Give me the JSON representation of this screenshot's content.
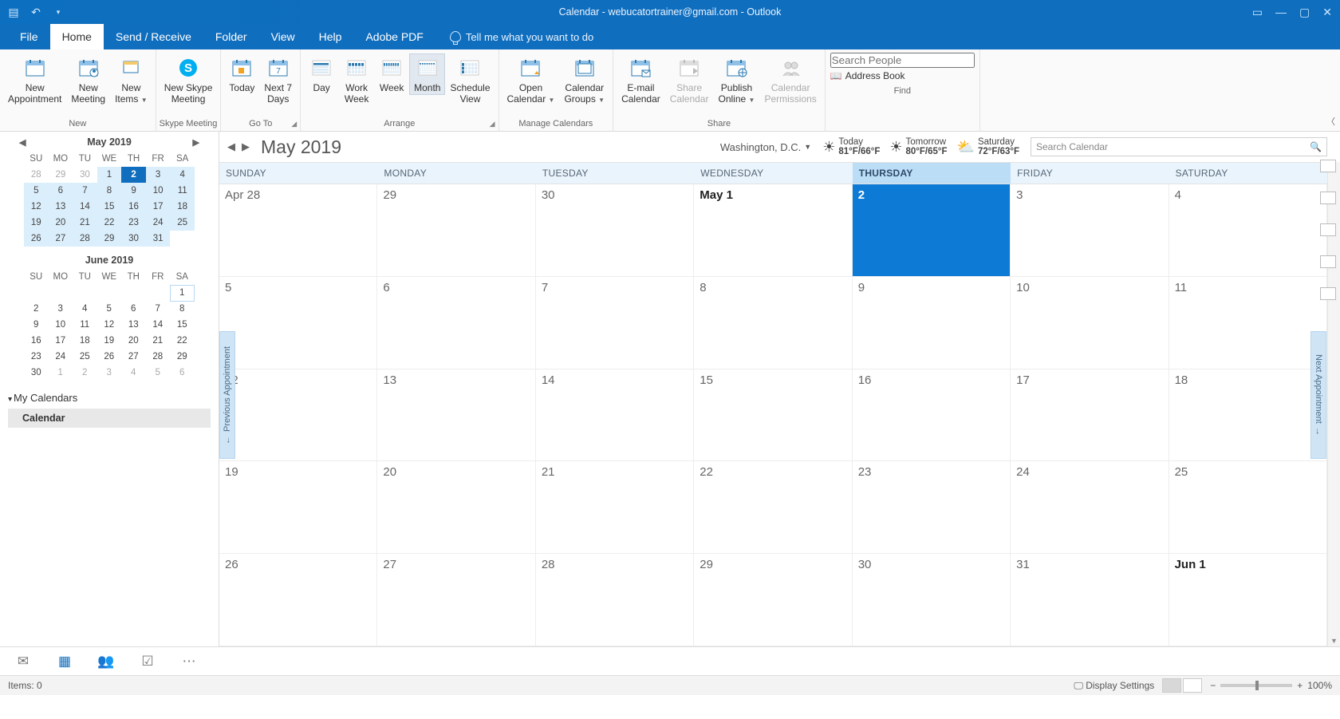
{
  "titlebar": {
    "title": "Calendar - webucatortrainer@gmail.com  -  Outlook"
  },
  "tabs": [
    "File",
    "Home",
    "Send / Receive",
    "Folder",
    "View",
    "Help",
    "Adobe PDF"
  ],
  "active_tab": "Home",
  "tellme": "Tell me what you want to do",
  "ribbon": {
    "groups": [
      {
        "label": "New",
        "buttons": [
          {
            "l1": "New",
            "l2": "Appointment",
            "icon": "cal",
            "drop": false
          },
          {
            "l1": "New",
            "l2": "Meeting",
            "icon": "people",
            "drop": false
          },
          {
            "l1": "New",
            "l2": "Items",
            "icon": "items",
            "drop": true
          }
        ]
      },
      {
        "label": "Skype Meeting",
        "buttons": [
          {
            "l1": "New Skype",
            "l2": "Meeting",
            "icon": "skype"
          }
        ]
      },
      {
        "label": "Go To",
        "launcher": true,
        "buttons": [
          {
            "l1": "Today",
            "l2": "",
            "icon": "today"
          },
          {
            "l1": "Next 7",
            "l2": "Days",
            "icon": "next7"
          }
        ]
      },
      {
        "label": "Arrange",
        "launcher": true,
        "buttons": [
          {
            "l1": "Day",
            "l2": "",
            "icon": "day"
          },
          {
            "l1": "Work",
            "l2": "Week",
            "icon": "wweek"
          },
          {
            "l1": "Week",
            "l2": "",
            "icon": "week"
          },
          {
            "l1": "Month",
            "l2": "",
            "icon": "month",
            "selected": true
          },
          {
            "l1": "Schedule",
            "l2": "View",
            "icon": "sched"
          }
        ]
      },
      {
        "label": "Manage Calendars",
        "buttons": [
          {
            "l1": "Open",
            "l2": "Calendar",
            "icon": "opencal",
            "drop": true
          },
          {
            "l1": "Calendar",
            "l2": "Groups",
            "icon": "calgrp",
            "drop": true
          }
        ]
      },
      {
        "label": "Share",
        "buttons": [
          {
            "l1": "E-mail",
            "l2": "Calendar",
            "icon": "emailcal"
          },
          {
            "l1": "Share",
            "l2": "Calendar",
            "icon": "sharecal",
            "disabled": true
          },
          {
            "l1": "Publish",
            "l2": "Online",
            "icon": "pub",
            "drop": true
          },
          {
            "l1": "Calendar",
            "l2": "Permissions",
            "icon": "perm",
            "disabled": true
          }
        ]
      }
    ],
    "find": {
      "search_ph": "Search People",
      "addressbook": "Address Book",
      "label": "Find"
    }
  },
  "mini_months": [
    {
      "title": "May 2019",
      "dow": [
        "SU",
        "MO",
        "TU",
        "WE",
        "TH",
        "FR",
        "SA"
      ],
      "weeks": [
        [
          {
            "d": "28",
            "o": 1
          },
          {
            "d": "29",
            "o": 1
          },
          {
            "d": "30",
            "o": 1
          },
          {
            "d": "1",
            "m": 1
          },
          {
            "d": "2",
            "t": 1
          },
          {
            "d": "3",
            "m": 1
          },
          {
            "d": "4",
            "m": 1
          }
        ],
        [
          {
            "d": "5",
            "m": 1
          },
          {
            "d": "6",
            "m": 1
          },
          {
            "d": "7",
            "m": 1
          },
          {
            "d": "8",
            "m": 1
          },
          {
            "d": "9",
            "m": 1
          },
          {
            "d": "10",
            "m": 1
          },
          {
            "d": "11",
            "m": 1
          }
        ],
        [
          {
            "d": "12",
            "m": 1
          },
          {
            "d": "13",
            "m": 1
          },
          {
            "d": "14",
            "m": 1
          },
          {
            "d": "15",
            "m": 1
          },
          {
            "d": "16",
            "m": 1
          },
          {
            "d": "17",
            "m": 1
          },
          {
            "d": "18",
            "m": 1
          }
        ],
        [
          {
            "d": "19",
            "m": 1
          },
          {
            "d": "20",
            "m": 1
          },
          {
            "d": "21",
            "m": 1
          },
          {
            "d": "22",
            "m": 1
          },
          {
            "d": "23",
            "m": 1
          },
          {
            "d": "24",
            "m": 1
          },
          {
            "d": "25",
            "m": 1
          }
        ],
        [
          {
            "d": "26",
            "m": 1
          },
          {
            "d": "27",
            "m": 1
          },
          {
            "d": "28",
            "m": 1
          },
          {
            "d": "29",
            "m": 1
          },
          {
            "d": "30",
            "m": 1
          },
          {
            "d": "31",
            "m": 1
          },
          {
            "d": ""
          }
        ]
      ]
    },
    {
      "title": "June 2019",
      "dow": [
        "SU",
        "MO",
        "TU",
        "WE",
        "TH",
        "FR",
        "SA"
      ],
      "weeks": [
        [
          {
            "d": ""
          },
          {
            "d": ""
          },
          {
            "d": ""
          },
          {
            "d": ""
          },
          {
            "d": ""
          },
          {
            "d": ""
          },
          {
            "d": "1",
            "b": 1
          }
        ],
        [
          {
            "d": "2"
          },
          {
            "d": "3"
          },
          {
            "d": "4"
          },
          {
            "d": "5"
          },
          {
            "d": "6"
          },
          {
            "d": "7"
          },
          {
            "d": "8"
          }
        ],
        [
          {
            "d": "9"
          },
          {
            "d": "10"
          },
          {
            "d": "11"
          },
          {
            "d": "12"
          },
          {
            "d": "13"
          },
          {
            "d": "14"
          },
          {
            "d": "15"
          }
        ],
        [
          {
            "d": "16"
          },
          {
            "d": "17"
          },
          {
            "d": "18"
          },
          {
            "d": "19"
          },
          {
            "d": "20"
          },
          {
            "d": "21"
          },
          {
            "d": "22"
          }
        ],
        [
          {
            "d": "23"
          },
          {
            "d": "24"
          },
          {
            "d": "25"
          },
          {
            "d": "26"
          },
          {
            "d": "27"
          },
          {
            "d": "28"
          },
          {
            "d": "29"
          }
        ],
        [
          {
            "d": "30"
          },
          {
            "d": "1",
            "o": 1
          },
          {
            "d": "2",
            "o": 1
          },
          {
            "d": "3",
            "o": 1
          },
          {
            "d": "4",
            "o": 1
          },
          {
            "d": "5",
            "o": 1
          },
          {
            "d": "6",
            "o": 1
          }
        ]
      ]
    }
  ],
  "mycal": {
    "header": "My Calendars",
    "item": "Calendar"
  },
  "calview": {
    "title": "May 2019",
    "location": "Washington,  D.C.",
    "forecast": [
      {
        "label": "Today",
        "temp": "81°F/66°F"
      },
      {
        "label": "Tomorrow",
        "temp": "80°F/65°F"
      },
      {
        "label": "Saturday",
        "temp": "72°F/63°F"
      }
    ],
    "search_ph": "Search Calendar",
    "dow": [
      "SUNDAY",
      "MONDAY",
      "TUESDAY",
      "WEDNESDAY",
      "THURSDAY",
      "FRIDAY",
      "SATURDAY"
    ],
    "today_col": 4,
    "cells": [
      {
        "t": "Apr 28"
      },
      {
        "t": "29"
      },
      {
        "t": "30"
      },
      {
        "t": "May 1",
        "b": 1
      },
      {
        "t": "2",
        "today": 1
      },
      {
        "t": "3"
      },
      {
        "t": "4"
      },
      {
        "t": "5"
      },
      {
        "t": "6"
      },
      {
        "t": "7"
      },
      {
        "t": "8"
      },
      {
        "t": "9"
      },
      {
        "t": "10"
      },
      {
        "t": "11"
      },
      {
        "t": "12"
      },
      {
        "t": "13"
      },
      {
        "t": "14"
      },
      {
        "t": "15"
      },
      {
        "t": "16"
      },
      {
        "t": "17"
      },
      {
        "t": "18"
      },
      {
        "t": "19"
      },
      {
        "t": "20"
      },
      {
        "t": "21"
      },
      {
        "t": "22"
      },
      {
        "t": "23"
      },
      {
        "t": "24"
      },
      {
        "t": "25"
      },
      {
        "t": "26"
      },
      {
        "t": "27"
      },
      {
        "t": "28"
      },
      {
        "t": "29"
      },
      {
        "t": "30"
      },
      {
        "t": "31"
      },
      {
        "t": "Jun 1",
        "b": 1
      }
    ],
    "prev_apt": "Previous Appointment",
    "next_apt": "Next Appointment"
  },
  "status": {
    "items": "Items: 0",
    "display": "Display Settings",
    "zoom": "100%"
  }
}
